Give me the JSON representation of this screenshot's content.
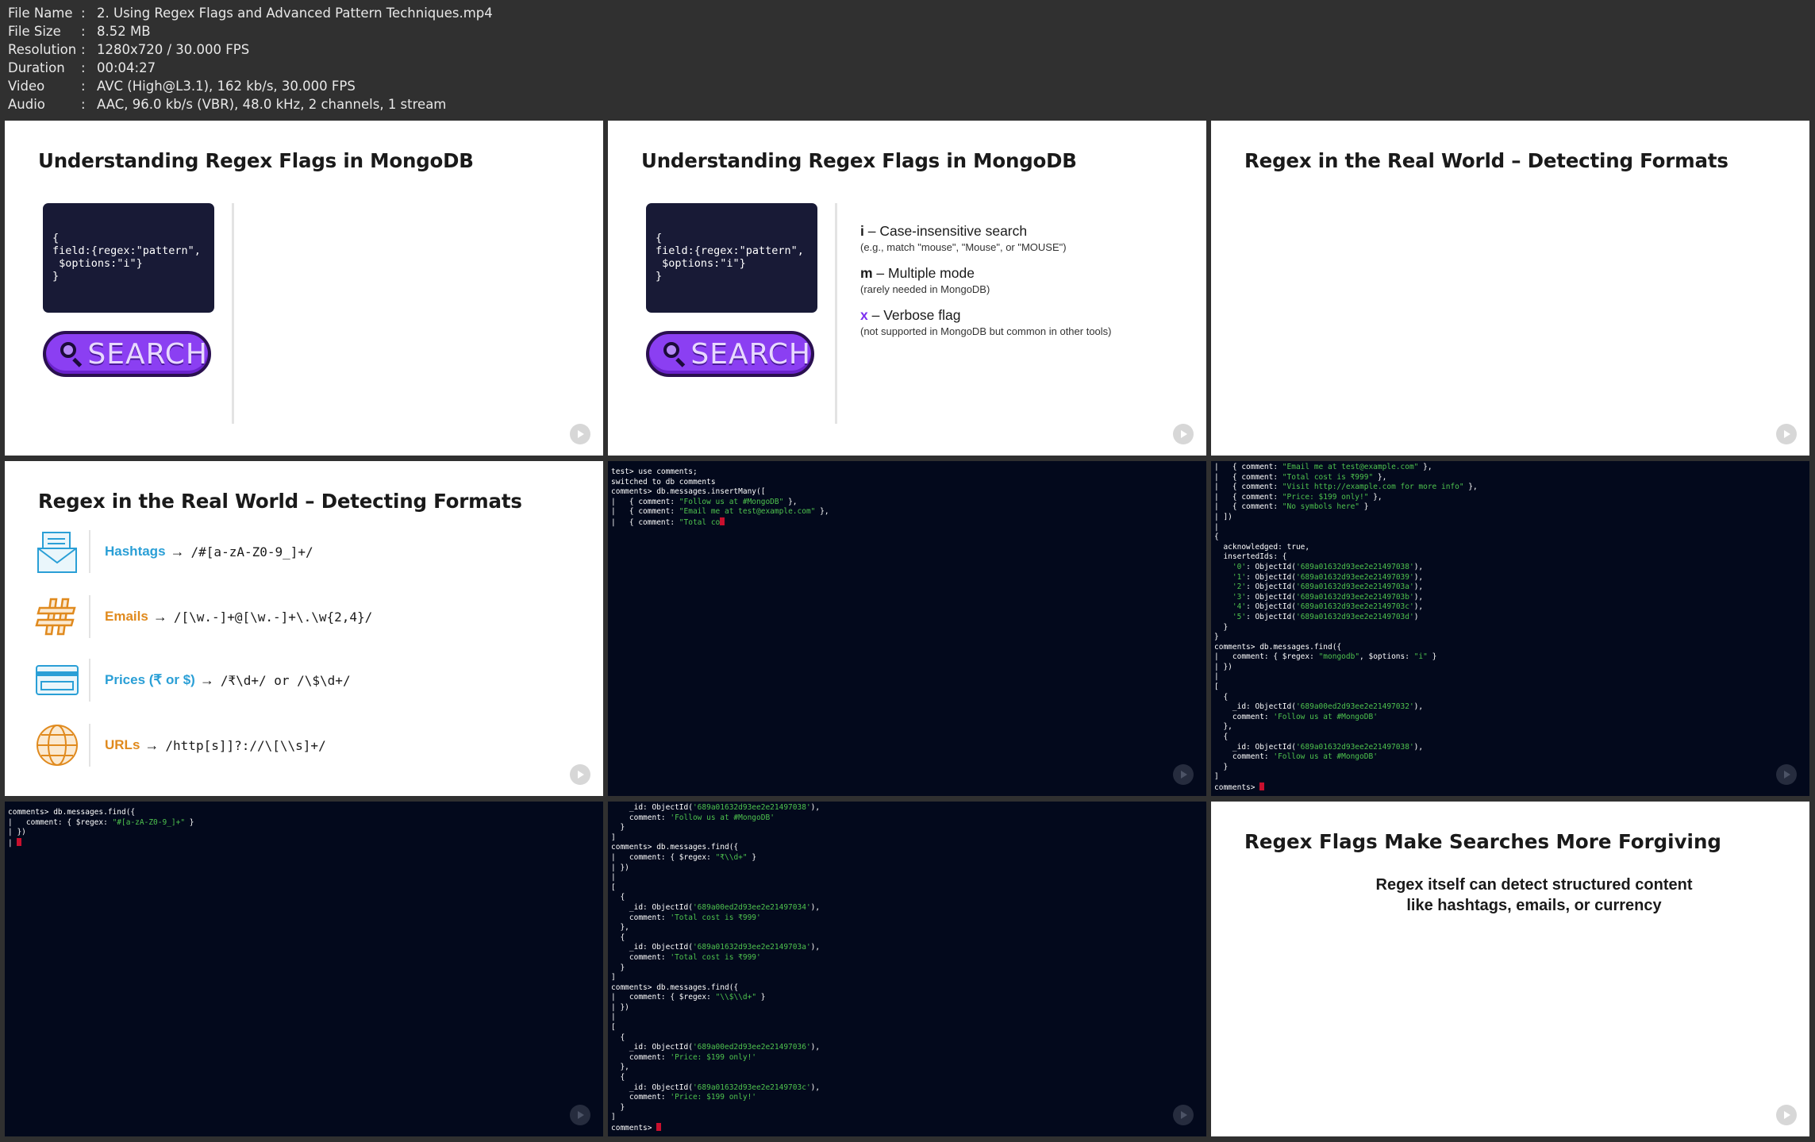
{
  "meta": [
    {
      "key": "File Name",
      "value": "2. Using Regex Flags and Advanced Pattern Techniques.mp4"
    },
    {
      "key": "File Size",
      "value": "8.52 MB"
    },
    {
      "key": "Resolution",
      "value": "1280x720 / 30.000 FPS"
    },
    {
      "key": "Duration",
      "value": "00:04:27"
    },
    {
      "key": "Video",
      "value": "AVC (High@L3.1), 162 kb/s, 30.000 FPS"
    },
    {
      "key": "Audio",
      "value": "AAC, 96.0 kb/s (VBR), 48.0 kHz, 2 channels, 1 stream"
    }
  ],
  "meta_sep": ":",
  "slide1": {
    "title": "Understanding Regex Flags in MongoDB",
    "code": [
      "{",
      "field:{regex:\"pattern\",",
      " $options:\"i\"}",
      "}"
    ],
    "search_label": "SEARCH"
  },
  "slide2": {
    "title": "Understanding Regex Flags in MongoDB",
    "code": [
      "{",
      "field:{regex:\"pattern\",",
      " $options:\"i\"}",
      "}"
    ],
    "search_label": "SEARCH",
    "flags": [
      {
        "key": "i",
        "name": " – Case-insensitive search",
        "note": "(e.g., match \"mouse\", \"Mouse\", or \"MOUSE\")"
      },
      {
        "key": "m",
        "name": " – Multiple mode",
        "note": "(rarely needed in MongoDB)"
      },
      {
        "key": "x",
        "name": " – Verbose flag",
        "note": "(not supported in MongoDB but common in other tools)"
      }
    ]
  },
  "slide3": {
    "title": "Regex in the Real World – Detecting Formats"
  },
  "slide4": {
    "title": "Regex in the Real World – Detecting Formats",
    "items": [
      {
        "name": "Hashtags",
        "arrow": "→",
        "pattern": "/#[a-zA-Z0-9_]+/",
        "color": "#2a9fd6"
      },
      {
        "name": "Emails",
        "arrow": "→",
        "pattern": "/[\\w.-]+@[\\w.-]+\\.\\w{2,4}/",
        "color": "#e08a1e"
      },
      {
        "name": "Prices (₹ or $)",
        "arrow": "→",
        "pattern": "/₹\\d+/ or /\\$\\d+/",
        "color": "#2a9fd6"
      },
      {
        "name": "URLs",
        "arrow": "→",
        "pattern": "/http[s]]?://\\[\\\\s]+/",
        "color": "#e08a1e"
      }
    ]
  },
  "term1": [
    "test> use comments;",
    "switched to db comments",
    "comments> db.messages.insertMany([",
    "|   { comment: \"Follow us at #MongoDB\" },",
    "|   { comment: \"Email me at test@example.com\" },",
    "|   { comment: \"Total co"
  ],
  "term2": [
    "|   { comment: \"Email me at test@example.com\" },",
    "|   { comment: \"Total cost is ₹999\" },",
    "|   { comment: \"Visit http://example.com for more info\" },",
    "|   { comment: \"Price: $199 only!\" },",
    "|   { comment: \"No symbols here\" }",
    "| ])",
    "|",
    "{",
    "  acknowledged: true,",
    "  insertedIds: {",
    "    '0': ObjectId('689a01632d93ee2e21497038'),",
    "    '1': ObjectId('689a01632d93ee2e21497039'),",
    "    '2': ObjectId('689a01632d93ee2e2149703a'),",
    "    '3': ObjectId('689a01632d93ee2e2149703b'),",
    "    '4': ObjectId('689a01632d93ee2e2149703c'),",
    "    '5': ObjectId('689a01632d93ee2e2149703d')",
    "  }",
    "}",
    "comments> db.messages.find({",
    "|   comment: { $regex: \"mongodb\", $options: \"i\" }",
    "| })",
    "|",
    "[",
    "  {",
    "    _id: ObjectId('689a00ed2d93ee2e21497032'),",
    "    comment: 'Follow us at #MongoDB'",
    "  },",
    "  {",
    "    _id: ObjectId('689a01632d93ee2e21497038'),",
    "    comment: 'Follow us at #MongoDB'",
    "  }",
    "]",
    "comments> "
  ],
  "term3": [
    "comments> db.messages.find({",
    "|   comment: { $regex: \"#[a-zA-Z0-9_]+\" }",
    "| })",
    "| "
  ],
  "term4": [
    "    _id: ObjectId('689a01632d93ee2e21497038'),",
    "    comment: 'Follow us at #MongoDB'",
    "  }",
    "]",
    "comments> db.messages.find({",
    "|   comment: { $regex: \"₹\\\\d+\" }",
    "| })",
    "|",
    "[",
    "  {",
    "    _id: ObjectId('689a00ed2d93ee2e21497034'),",
    "    comment: 'Total cost is ₹999'",
    "  },",
    "  {",
    "    _id: ObjectId('689a01632d93ee2e2149703a'),",
    "    comment: 'Total cost is ₹999'",
    "  }",
    "]",
    "comments> db.messages.find({",
    "|   comment: { $regex: \"\\\\$\\\\d+\" }",
    "| })",
    "|",
    "[",
    "  {",
    "    _id: ObjectId('689a00ed2d93ee2e21497036'),",
    "    comment: 'Price: $199 only!'",
    "  },",
    "  {",
    "    _id: ObjectId('689a01632d93ee2e2149703c'),",
    "    comment: 'Price: $199 only!'",
    "  }",
    "]",
    "comments> "
  ],
  "slide9": {
    "title": "Regex Flags Make Searches More Forgiving",
    "body": [
      "Regex itself can detect structured content",
      "like hashtags, emails, or currency"
    ]
  }
}
